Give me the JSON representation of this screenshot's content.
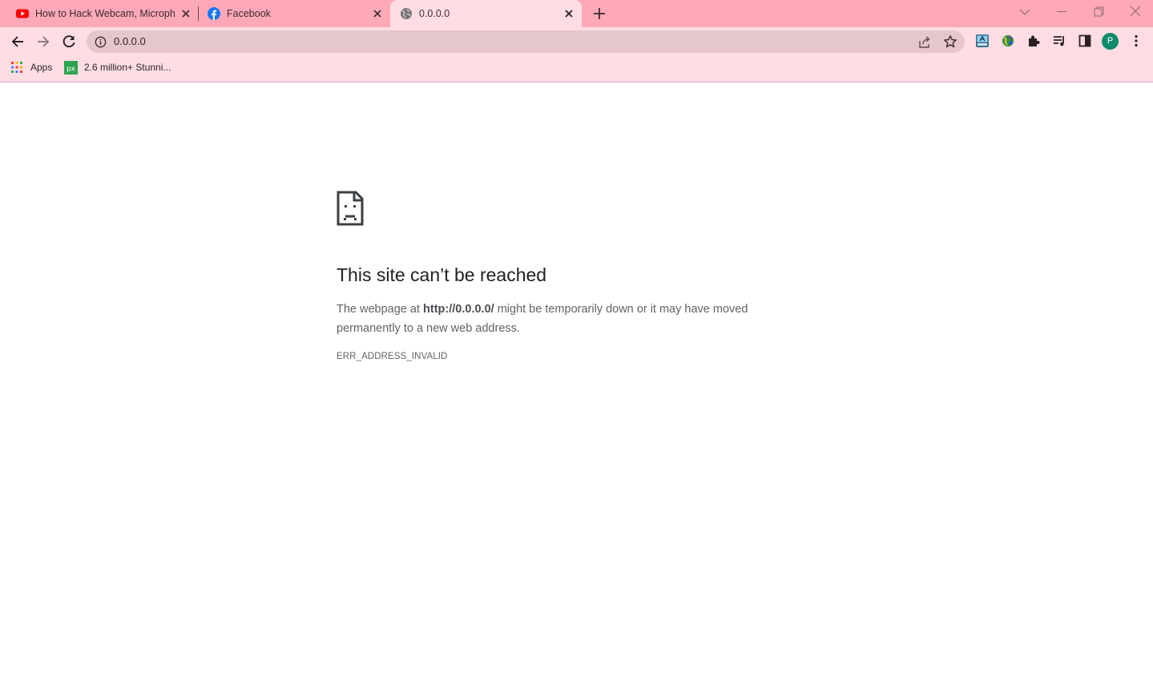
{
  "tabs": [
    {
      "title": "How to Hack Webcam, Microphone",
      "favicon": "youtube-icon"
    },
    {
      "title": "Facebook",
      "favicon": "facebook-icon"
    },
    {
      "title": "0.0.0.0",
      "favicon": "globe-icon",
      "active": true
    }
  ],
  "omnibox": {
    "url": "0.0.0.0",
    "left_icon": "info-icon"
  },
  "toolbar": {
    "avatar_letter": "P"
  },
  "bookmarks": [
    {
      "label": "Apps",
      "icon": "apps-grid-icon"
    },
    {
      "label": "2.6 million+ Stunni...",
      "icon": "pixabay-icon"
    }
  ],
  "error": {
    "heading": "This site can’t be reached",
    "desc_prefix": "The webpage at ",
    "desc_url": "http://0.0.0.0/",
    "desc_suffix": " might be temporarily down or it may have moved permanently to a new web address.",
    "code": "ERR_ADDRESS_INVALID"
  },
  "colors": {
    "tabstrip": "#ffa9b8",
    "toolbar": "#ffdde3",
    "omnibox": "#e5c6cc",
    "avatar": "#0f8a6a"
  }
}
